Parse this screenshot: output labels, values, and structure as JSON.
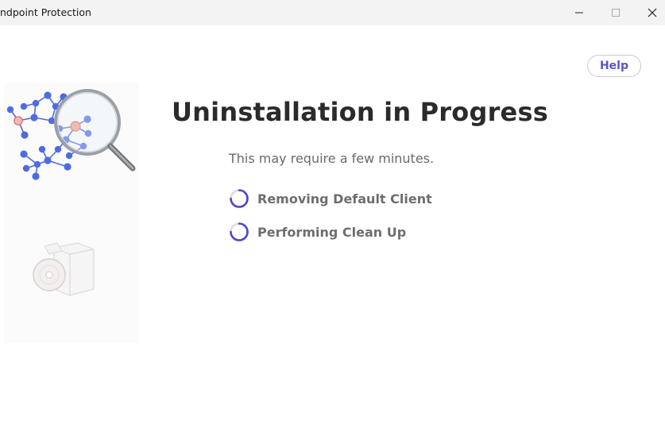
{
  "window": {
    "title": "ndpoint Protection",
    "controls": {
      "minimize_icon": "minimize-icon",
      "maximize_icon": "maximize-icon",
      "close_icon": "close-icon"
    }
  },
  "header": {
    "help_label": "Help"
  },
  "main": {
    "heading": "Uninstallation in Progress",
    "subtitle": "This may require a few minutes.",
    "steps": [
      {
        "label": "Removing Default Client",
        "status": "in-progress",
        "icon": "spinner-icon"
      },
      {
        "label": "Performing Clean Up",
        "status": "in-progress",
        "icon": "spinner-icon"
      }
    ]
  },
  "side_panel": {
    "graphics": [
      "network-magnifier-icon",
      "software-install-icon"
    ]
  },
  "colors": {
    "accent": "#5b55c9",
    "spinner": "#4f47c8",
    "heading": "#2b2b2b",
    "text_muted": "#6a6a6a",
    "node_blue": "#4f6be3",
    "node_red": "#e98a8a"
  }
}
